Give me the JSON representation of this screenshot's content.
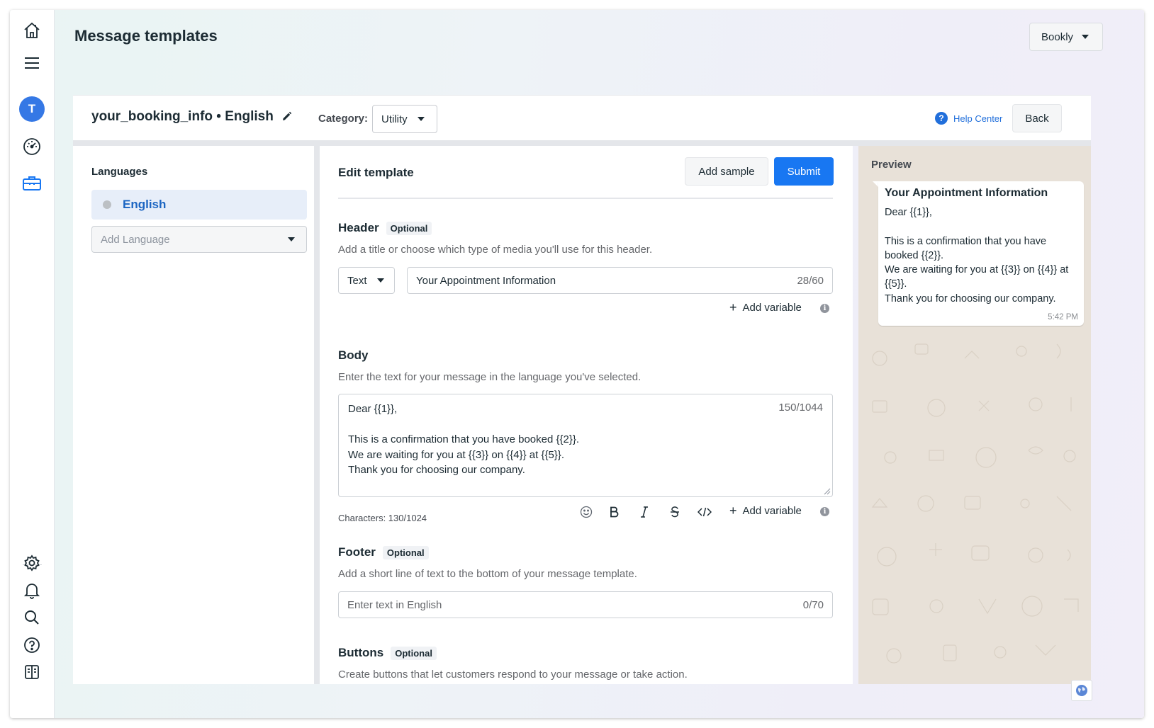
{
  "page": {
    "title": "Message templates",
    "account": "Bookly"
  },
  "nav": {
    "avatar_initial": "T",
    "icons": [
      "home-icon",
      "menu-icon",
      "dashboard-icon",
      "briefcase-icon",
      "gear-icon",
      "bell-icon",
      "search-icon",
      "help-icon",
      "panel-toggle-icon"
    ],
    "active_color": "#1877f2"
  },
  "template": {
    "name": "your_booking_info • English",
    "category_label": "Category:",
    "category_value": "Utility",
    "help_center": "Help Center",
    "back": "Back"
  },
  "languages": {
    "title": "Languages",
    "items": [
      {
        "label": "English",
        "selected": true
      }
    ],
    "add_placeholder": "Add Language"
  },
  "editor": {
    "title": "Edit template",
    "add_sample": "Add sample",
    "submit": "Submit",
    "header": {
      "title": "Header",
      "badge": "Optional",
      "description": "Add a title or choose which type of media you'll use for this header.",
      "type": "Text",
      "value": "Your Appointment Information",
      "counter": "28/60",
      "add_variable": "Add variable"
    },
    "body": {
      "title": "Body",
      "description": "Enter the text for your message in the language you've selected.",
      "value": "Dear {{1}},\n\nThis is a confirmation that you have booked {{2}}.\nWe are waiting for you at {{3}} on {{4}} at {{5}}.\nThank you for choosing our company.",
      "counter": "150/1044",
      "characters": "Characters: 130/1024",
      "toolbar": [
        "emoji-icon",
        "bold-icon",
        "italic-icon",
        "strikethrough-icon",
        "code-icon"
      ],
      "add_variable": "Add variable"
    },
    "footer": {
      "title": "Footer",
      "badge": "Optional",
      "description": "Add a short line of text to the bottom of your message template.",
      "placeholder": "Enter text in English",
      "counter": "0/70"
    },
    "buttons": {
      "title": "Buttons",
      "badge": "Optional",
      "description": "Create buttons that let customers respond to your message or take action."
    }
  },
  "preview": {
    "title": "Preview",
    "message_title": "Your Appointment Information",
    "message_body": "Dear {{1}},\n\nThis is a confirmation that you have booked {{2}}.\nWe are waiting for you at {{3}} on {{4}} at {{5}}.\nThank you for choosing our company.",
    "time": "5:42 PM"
  },
  "colors": {
    "primary": "#1877f2",
    "link": "#216fdb",
    "preview_bg": "#e8e1d8"
  }
}
